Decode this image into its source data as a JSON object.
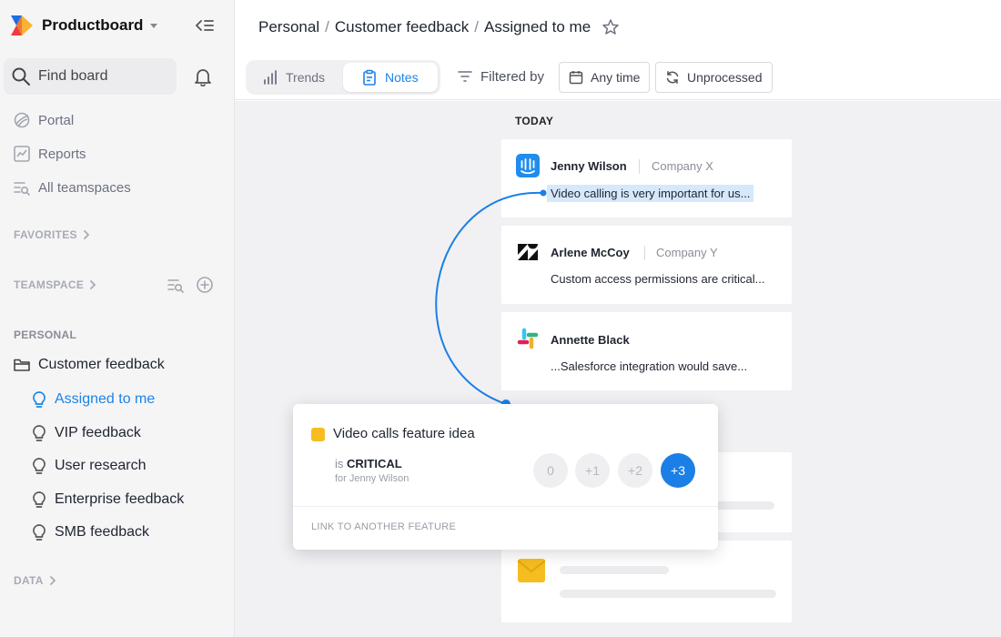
{
  "app": {
    "name": "Productboard",
    "colors": {
      "accent": "#1b83e8",
      "critical_flag": "#f5bd1f",
      "sidebar_bg": "#f5f5f6",
      "content_bg": "#f1f1f4"
    }
  },
  "sidebar": {
    "find_board": "Find board",
    "nav": [
      {
        "label": "Portal",
        "icon": "portal-icon"
      },
      {
        "label": "Reports",
        "icon": "reports-icon"
      },
      {
        "label": "All teamspaces",
        "icon": "teamspaces-icon"
      }
    ],
    "sections": {
      "favorites": "FAVORITES",
      "teamspace": "TEAMSPACE",
      "personal": "PERSONAL",
      "data": "DATA"
    },
    "folder": "Customer feedback",
    "boards": [
      {
        "label": "Assigned to me",
        "active": true
      },
      {
        "label": "VIP feedback",
        "active": false
      },
      {
        "label": "User research",
        "active": false
      },
      {
        "label": "Enterprise feedback",
        "active": false
      },
      {
        "label": "SMB feedback",
        "active": false
      }
    ]
  },
  "breadcrumb": {
    "items": [
      "Personal",
      "Customer feedback",
      "Assigned to me"
    ],
    "separator": "/"
  },
  "toolbar": {
    "tabs": [
      {
        "label": "Trends",
        "icon": "bar-chart-icon",
        "selected": false
      },
      {
        "label": "Notes",
        "icon": "clipboard-icon",
        "selected": true
      }
    ],
    "filtered_by": "Filtered by",
    "time_filter": "Any time",
    "status_filter": "Unprocessed"
  },
  "notes": {
    "group_label": "TODAY",
    "items": [
      {
        "name": "Jenny Wilson",
        "company": "Company X",
        "excerpt": "Video calling is very important for us...",
        "source": "intercom-icon"
      },
      {
        "name": "Arlene McCoy",
        "company": "Company Y",
        "excerpt": "Custom access permissions are critical...",
        "source": "zendesk-icon"
      },
      {
        "name": "Annette Black",
        "company": "",
        "excerpt": "...Salesforce integration would save...",
        "source": "slack-icon"
      }
    ]
  },
  "popup": {
    "feature": "Video calls feature idea",
    "importance_prefix": "is",
    "importance": "CRITICAL",
    "for_label": "for Jenny Wilson",
    "scores": [
      "0",
      "+1",
      "+2",
      "+3"
    ],
    "selected_score": "+3",
    "link_label": "LINK TO ANOTHER FEATURE"
  }
}
